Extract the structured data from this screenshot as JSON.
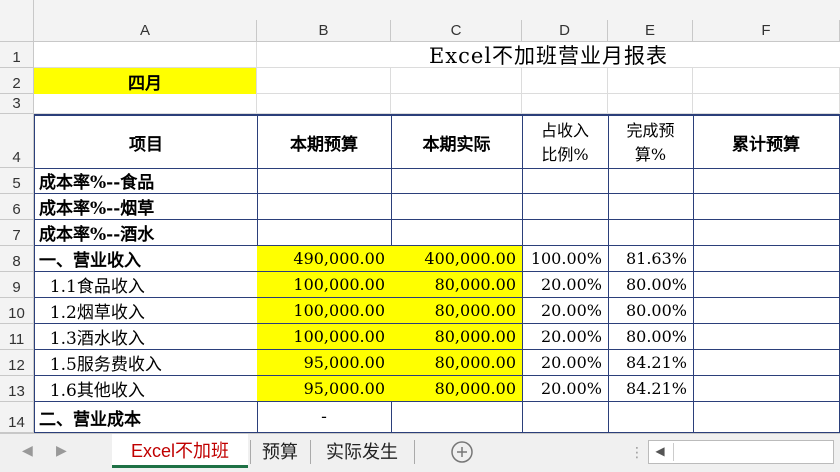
{
  "columns": [
    "A",
    "B",
    "C",
    "D",
    "E",
    "F"
  ],
  "rows": [
    "1",
    "2",
    "3",
    "4",
    "5",
    "6",
    "7",
    "8",
    "9",
    "10",
    "11",
    "12",
    "13",
    "14"
  ],
  "title": "Excel不加班营业月报表",
  "month": "四月",
  "headers": {
    "item": "项目",
    "budget": "本期预算",
    "actual": "本期实际",
    "ratio_l1": "占收入",
    "ratio_l2": "比例%",
    "complete_l1": "完成预",
    "complete_l2": "算%",
    "cum": "累计预算"
  },
  "table": [
    {
      "item": "成本率%--食品",
      "budget": "",
      "actual": "",
      "ratio": "",
      "complete": ""
    },
    {
      "item": "成本率%--烟草",
      "budget": "",
      "actual": "",
      "ratio": "",
      "complete": ""
    },
    {
      "item": "成本率%--酒水",
      "budget": "",
      "actual": "",
      "ratio": "",
      "complete": ""
    },
    {
      "item": "一、营业收入",
      "budget": "490,000.00",
      "actual": "400,000.00",
      "ratio": "100.00%",
      "complete": "81.63%"
    },
    {
      "item": "  1.1食品收入",
      "budget": "100,000.00",
      "actual": "80,000.00",
      "ratio": "20.00%",
      "complete": "80.00%"
    },
    {
      "item": "  1.2烟草收入",
      "budget": "100,000.00",
      "actual": "80,000.00",
      "ratio": "20.00%",
      "complete": "80.00%"
    },
    {
      "item": "  1.3酒水收入",
      "budget": "100,000.00",
      "actual": "80,000.00",
      "ratio": "20.00%",
      "complete": "80.00%"
    },
    {
      "item": "  1.5服务费收入",
      "budget": "95,000.00",
      "actual": "80,000.00",
      "ratio": "20.00%",
      "complete": "84.21%"
    },
    {
      "item": "  1.6其他收入",
      "budget": "95,000.00",
      "actual": "80,000.00",
      "ratio": "20.00%",
      "complete": "84.21%"
    },
    {
      "item": "二、营业成本",
      "budget": "-",
      "actual": "",
      "ratio": "",
      "complete": ""
    }
  ],
  "tabs": {
    "sheet1": "Excel不加班",
    "sheet2": "预算",
    "sheet3": "实际发生"
  },
  "icons": {
    "add_sheet": "plus-circle-icon",
    "scroll_left": "chevron-left-icon",
    "nav_prev": "triangle-left-icon",
    "nav_next": "triangle-right-icon"
  },
  "colors": {
    "highlight": "#ffff00",
    "border": "#2b3f7a",
    "active_tab_text": "#c00000"
  }
}
